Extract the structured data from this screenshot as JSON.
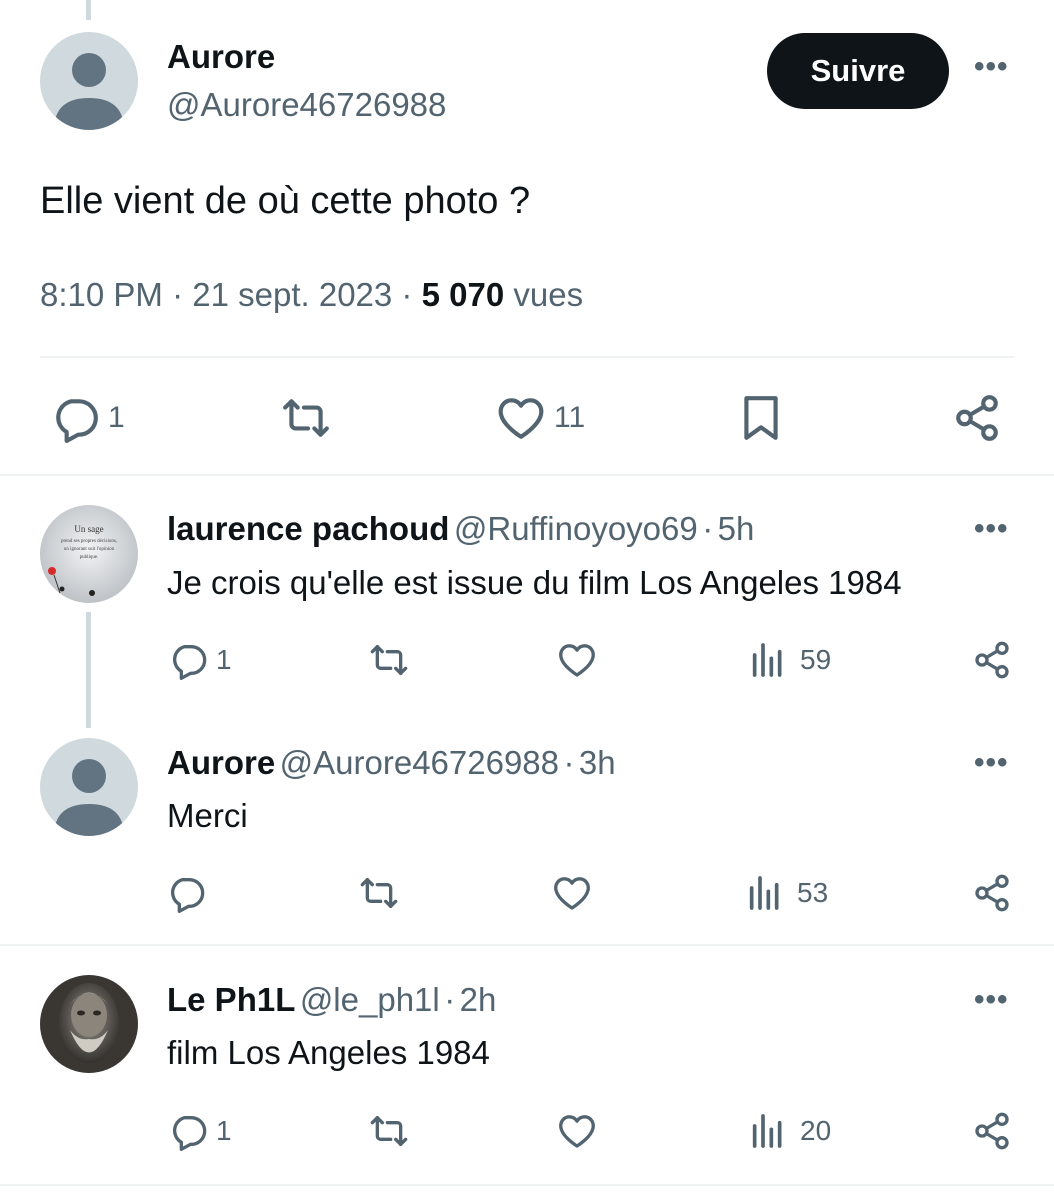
{
  "main_tweet": {
    "author_name": "Aurore",
    "author_handle": "@Aurore46726988",
    "follow_label": "Suivre",
    "more_label": "•••",
    "text": "Elle vient de où cette photo ?",
    "time": "8:10 PM",
    "date": "21 sept. 2023",
    "separator": "·",
    "views_count": "5 070",
    "views_label": "vues",
    "replies": "1",
    "likes": "11"
  },
  "replies": [
    {
      "name": "laurence pachoud",
      "handle": "@Ruffinoyoyo69",
      "time": "5h",
      "text": "Je crois qu'elle est issue du  film Los Angeles 1984",
      "replies": "1",
      "views": "59"
    },
    {
      "name": "Aurore",
      "handle": "@Aurore46726988",
      "time": "3h",
      "text": "Merci",
      "replies": "",
      "views": "53"
    },
    {
      "name": "Le Ph1L",
      "handle": "@le_ph1l",
      "time": "2h",
      "text": "film Los Angeles 1984",
      "replies": "1",
      "views": "20"
    }
  ],
  "avatar_quote": [
    "Un sage",
    "prend ses propres décisions,",
    "un ignorant suit l'opinion",
    "publique."
  ],
  "icons": {
    "reply": "reply-icon",
    "retweet": "retweet-icon",
    "like": "heart-icon",
    "bookmark": "bookmark-icon",
    "share": "share-icon",
    "views": "views-icon",
    "more": "more-icon"
  },
  "colors": {
    "text": "#0f1419",
    "muted": "#536471",
    "divider": "#eff3f4",
    "thread": "#cfd9de",
    "button": "#0f1419"
  }
}
